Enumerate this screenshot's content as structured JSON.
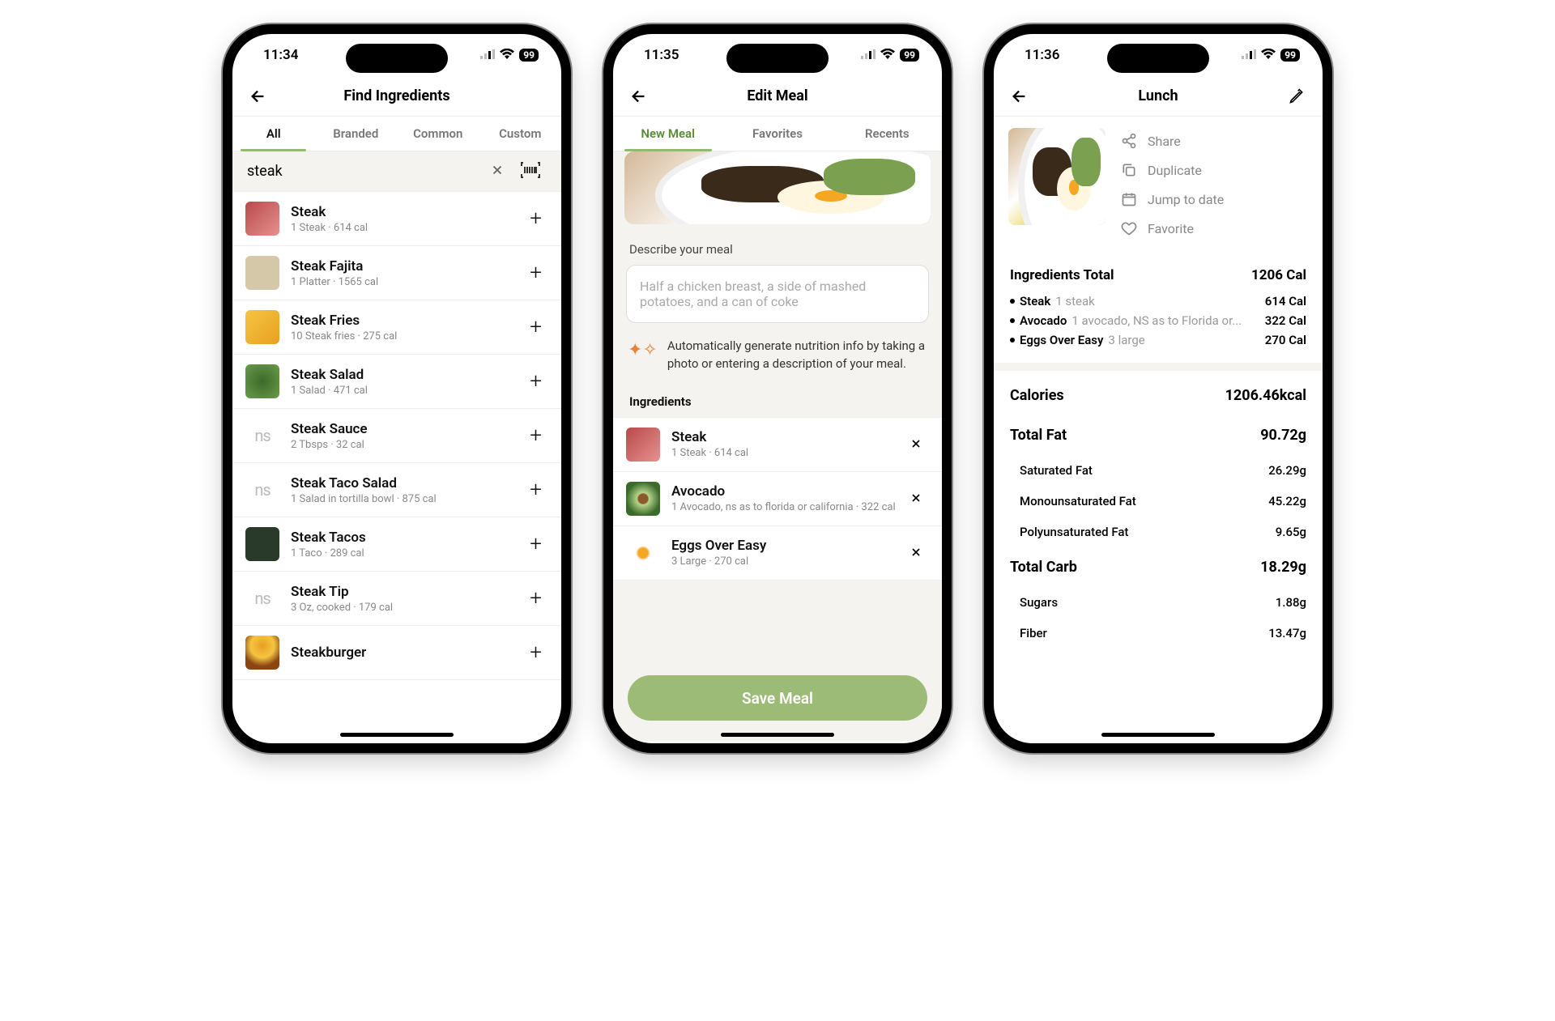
{
  "status_times": [
    "11:34",
    "11:35",
    "11:36"
  ],
  "battery": "99",
  "screen1": {
    "title": "Find Ingredients",
    "tabs": [
      "All",
      "Branded",
      "Common",
      "Custom"
    ],
    "search_value": "steak",
    "items": [
      {
        "name": "Steak",
        "sub": "1 Steak · 614 cal",
        "thumb": "steak"
      },
      {
        "name": "Steak Fajita",
        "sub": "1 Platter · 1565 cal",
        "thumb": "fajita"
      },
      {
        "name": "Steak Fries",
        "sub": "10 Steak fries · 275 cal",
        "thumb": "fries"
      },
      {
        "name": "Steak Salad",
        "sub": "1 Salad · 471 cal",
        "thumb": "salad"
      },
      {
        "name": "Steak Sauce",
        "sub": "2 Tbsps · 32 cal",
        "thumb": "ns"
      },
      {
        "name": "Steak Taco Salad",
        "sub": "1 Salad in tortilla bowl · 875 cal",
        "thumb": "ns"
      },
      {
        "name": "Steak Tacos",
        "sub": "1 Taco · 289 cal",
        "thumb": "tacos"
      },
      {
        "name": "Steak Tip",
        "sub": "3 Oz, cooked · 179 cal",
        "thumb": "ns"
      },
      {
        "name": "Steakburger",
        "sub": "",
        "thumb": "burger"
      }
    ]
  },
  "screen2": {
    "title": "Edit Meal",
    "tabs": [
      "New Meal",
      "Favorites",
      "Recents"
    ],
    "describe_label": "Describe your meal",
    "describe_placeholder": "Half a chicken breast, a side of mashed potatoes, and a can of coke",
    "ai_text": "Automatically generate nutrition info by taking a photo or entering a description of your meal.",
    "ingredients_label": "Ingredients",
    "ingredients": [
      {
        "name": "Steak",
        "sub": "1 Steak · 614 cal",
        "thumb": "steak"
      },
      {
        "name": "Avocado",
        "sub": "1 Avocado, ns as to florida or california · 322 cal",
        "thumb": "avocado"
      },
      {
        "name": "Eggs Over Easy",
        "sub": "3 Large · 270 cal",
        "thumb": "egg"
      }
    ],
    "save_label": "Save Meal"
  },
  "screen3": {
    "title": "Lunch",
    "actions": [
      "Share",
      "Duplicate",
      "Jump to date",
      "Favorite"
    ],
    "total_label": "Ingredients Total",
    "total_cal": "1206 Cal",
    "ingredients": [
      {
        "name": "Steak",
        "amt": "1 steak",
        "cal": "614 Cal"
      },
      {
        "name": "Avocado",
        "amt": "1 avocado, NS as to Florida or...",
        "cal": "322 Cal"
      },
      {
        "name": "Eggs Over Easy",
        "amt": "3 large",
        "cal": "270 Cal"
      }
    ],
    "nutrition": [
      {
        "label": "Calories",
        "value": "1206.46kcal",
        "sub": []
      },
      {
        "label": "Total Fat",
        "value": "90.72g",
        "sub": [
          {
            "label": "Saturated Fat",
            "value": "26.29g"
          },
          {
            "label": "Monounsaturated Fat",
            "value": "45.22g"
          },
          {
            "label": "Polyunsaturated Fat",
            "value": "9.65g"
          }
        ]
      },
      {
        "label": "Total Carb",
        "value": "18.29g",
        "sub": [
          {
            "label": "Sugars",
            "value": "1.88g"
          },
          {
            "label": "Fiber",
            "value": "13.47g"
          }
        ]
      }
    ]
  }
}
